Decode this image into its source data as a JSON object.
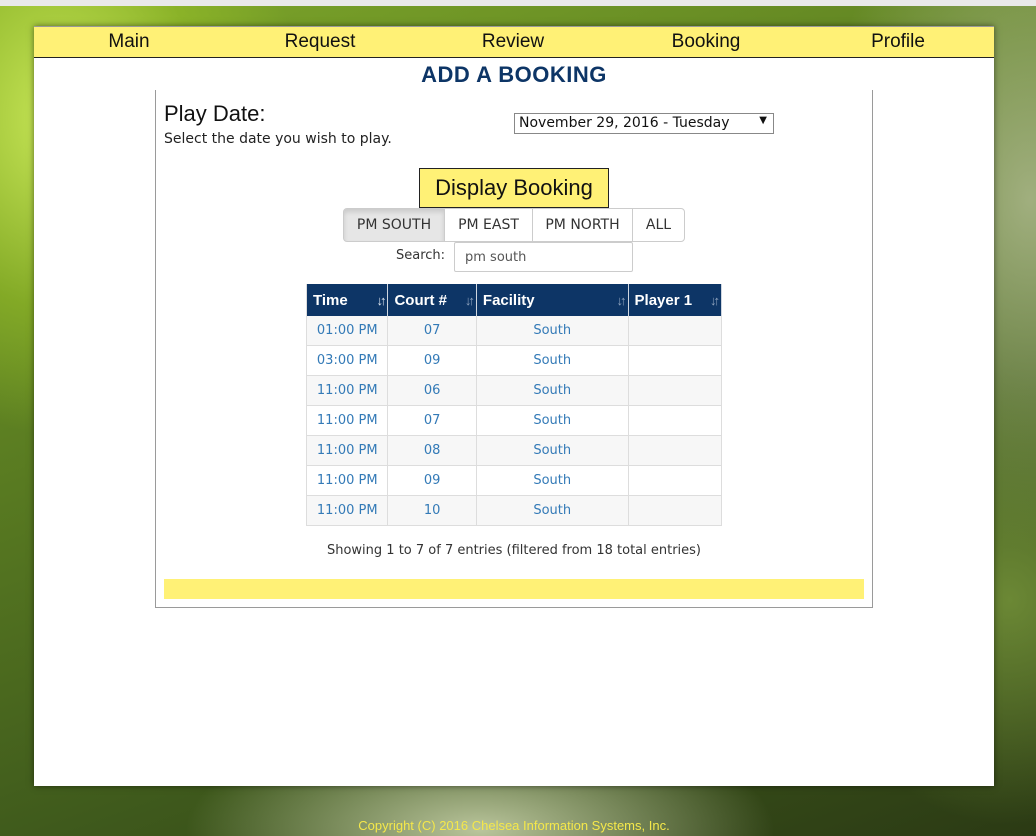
{
  "nav": {
    "items": [
      "Main",
      "Request",
      "Review",
      "Booking",
      "Profile"
    ]
  },
  "page_title": "ADD A BOOKING",
  "play_date": {
    "label": "Play Date:",
    "help": "Select the date you wish to play.",
    "selected": "November 29, 2016 - Tuesday"
  },
  "display_button": "Display Booking",
  "filters": [
    {
      "label": "PM SOUTH",
      "active": true
    },
    {
      "label": "PM EAST",
      "active": false
    },
    {
      "label": "PM NORTH",
      "active": false
    },
    {
      "label": "ALL",
      "active": false
    }
  ],
  "search": {
    "label": "Search:",
    "value": "pm south"
  },
  "table": {
    "columns": [
      "Time",
      "Court #",
      "Facility",
      "Player 1"
    ],
    "rows": [
      [
        "01:00 PM",
        "07",
        "South",
        ""
      ],
      [
        "03:00 PM",
        "09",
        "South",
        ""
      ],
      [
        "11:00 PM",
        "06",
        "South",
        ""
      ],
      [
        "11:00 PM",
        "07",
        "South",
        ""
      ],
      [
        "11:00 PM",
        "08",
        "South",
        ""
      ],
      [
        "11:00 PM",
        "09",
        "South",
        ""
      ],
      [
        "11:00 PM",
        "10",
        "South",
        ""
      ]
    ],
    "info": "Showing 1 to 7 of 7 entries (filtered from 18 total entries)"
  },
  "footer": {
    "copyright": "Copyright (C) 2016 Chelsea Information Systems, Inc."
  },
  "colors": {
    "nav_bg": "#fff176",
    "header_bg": "#0d3566",
    "link": "#337ab7"
  }
}
